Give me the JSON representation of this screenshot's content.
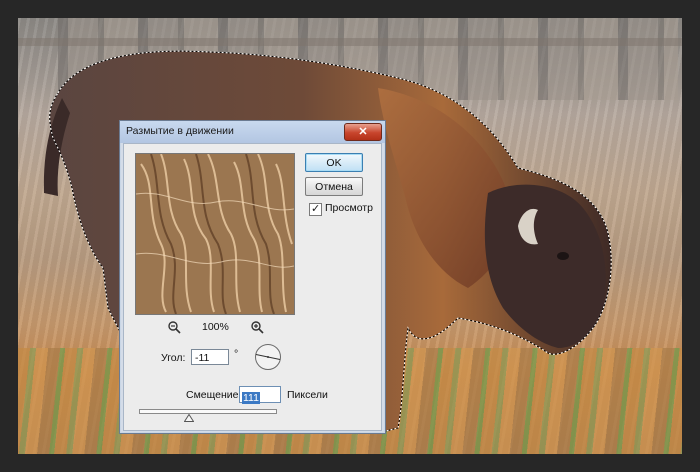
{
  "dialog": {
    "title": "Размытие в движении",
    "close_symbol": "✕",
    "ok_label": "OK",
    "cancel_label": "Отмена",
    "preview_label": "Просмотр",
    "preview_checked": true,
    "zoom_value": "100%",
    "angle_label": "Угол:",
    "angle_value": "-11",
    "angle_unit": "°",
    "distance_label": "Смещение:",
    "distance_value": "111",
    "distance_unit": "Пиксели",
    "distance_slider_fraction": 0.36
  },
  "icons": {
    "zoom_out": "zoom-out-icon",
    "zoom_in": "zoom-in-icon",
    "angle_dial": "angle-dial-icon",
    "slider_thumb": "slider-thumb-icon"
  },
  "colors": {
    "dialog_bg": "#ececec",
    "title_bar": "#b3c6e2",
    "close_button": "#c8452d",
    "selection_highlight": "#3b79c4"
  }
}
